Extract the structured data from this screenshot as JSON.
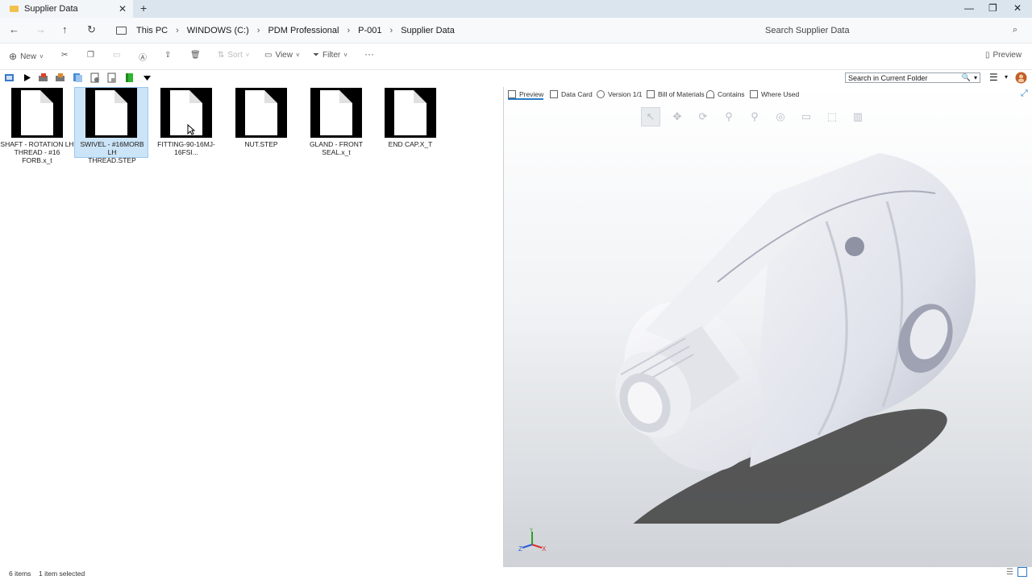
{
  "window": {
    "tab_title": "Supplier Data",
    "tab_close": "✕",
    "new_tab": "+",
    "minimize": "—",
    "restore": "❐",
    "close": "✕"
  },
  "nav": {
    "back": "←",
    "forward": "→",
    "up": "↑",
    "refresh": "↻"
  },
  "breadcrumb": {
    "items": [
      "This PC",
      "WINDOWS (C:)",
      "PDM Professional",
      "P-001",
      "Supplier Data"
    ],
    "separator": "›"
  },
  "search": {
    "placeholder": "Search Supplier Data",
    "icon": "⌕"
  },
  "commandbar": {
    "new": "New",
    "sort": "Sort",
    "view": "View",
    "filter": "Filter",
    "more": "···",
    "preview": "Preview"
  },
  "pdm_toolbar": {
    "folder_search_placeholder": "Search in Current Folder",
    "icons": [
      "pdm-refresh-icon",
      "play-icon",
      "check-out-icon",
      "check-in-icon",
      "copy-tree-icon",
      "get-version-icon",
      "reference-icon",
      "green-file-icon",
      "dropdown-icon"
    ]
  },
  "files": [
    {
      "name": "SHAFT - ROTATION LH THREAD - #16 FORB.x_t",
      "line1": "SHAFT - ROTATION LH",
      "line2": "THREAD - #16 FORB.x_t",
      "selected": false
    },
    {
      "name": "SWIVEL - #16MORB LH THREAD.STEP",
      "line1": "SWIVEL - #16MORB LH",
      "line2": "THREAD.STEP",
      "selected": true
    },
    {
      "name": "FITTING-90-16MJ-16FSI...",
      "line1": "FITTING-90-16MJ-16FSI...",
      "line2": "",
      "selected": false
    },
    {
      "name": "NUT.STEP",
      "line1": "NUT.STEP",
      "line2": "",
      "selected": false
    },
    {
      "name": "GLAND - FRONT SEAL.x_t",
      "line1": "GLAND - FRONT SEAL.x_t",
      "line2": "",
      "selected": false
    },
    {
      "name": "END CAP.X_T",
      "line1": "END CAP.X_T",
      "line2": "",
      "selected": false
    }
  ],
  "preview_tabs": [
    "Preview",
    "Data Card",
    "Version 1/1",
    "Bill of Materials",
    "Contains",
    "Where Used"
  ],
  "axes": {
    "x": "X",
    "y": "Y",
    "z": "Z"
  },
  "status": {
    "items": "6 items",
    "selected": "1 item selected"
  },
  "colors": {
    "accent": "#2b7bc8",
    "selection": "#cce4f7",
    "folder": "#f2c14b"
  }
}
